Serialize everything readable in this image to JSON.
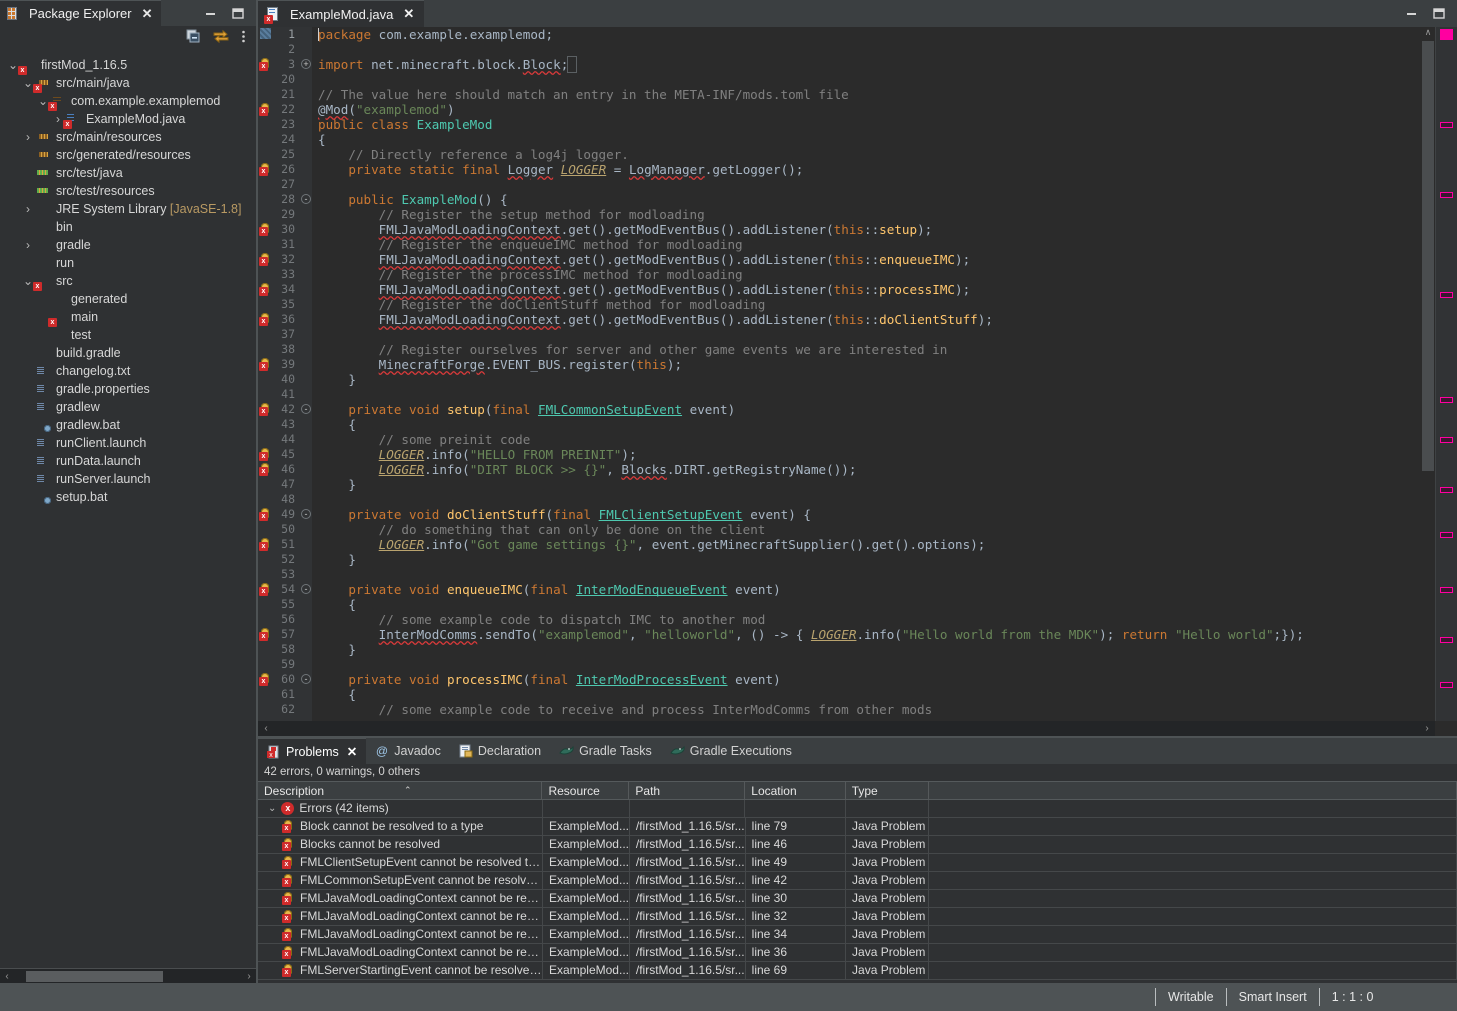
{
  "window": {
    "minimize_label": "Minimize",
    "maximize_label": "Maximize"
  },
  "package_explorer": {
    "tab_label": "Package Explorer",
    "tab_close": "✕",
    "icon": "package-explorer-icon",
    "toolbar": {
      "collapse_all": "collapse-all-icon",
      "link_with_editor": "link-with-editor-icon",
      "view_menu": "view-menu-icon"
    },
    "tree": [
      {
        "label": "firstMod_1.16.5",
        "indent": 0,
        "arrow": "down",
        "icon": "project",
        "error": true
      },
      {
        "label": "src/main/java",
        "indent": 1,
        "arrow": "down",
        "icon": "pkgfrag",
        "error": true
      },
      {
        "label": "com.example.examplemod",
        "indent": 2,
        "arrow": "down",
        "icon": "package",
        "error": true
      },
      {
        "label": "ExampleMod.java",
        "indent": 3,
        "arrow": "right",
        "icon": "java",
        "error": true
      },
      {
        "label": "src/main/resources",
        "indent": 1,
        "arrow": "right",
        "icon": "pkgfrag",
        "error": false
      },
      {
        "label": "src/generated/resources",
        "indent": 1,
        "arrow": "none",
        "icon": "pkgfrag",
        "error": false
      },
      {
        "label": "src/test/java",
        "indent": 1,
        "arrow": "none",
        "icon": "pkgfrag-green",
        "error": false
      },
      {
        "label": "src/test/resources",
        "indent": 1,
        "arrow": "none",
        "icon": "pkgfrag-green",
        "error": false
      },
      {
        "label": "JRE System Library ",
        "suffix": "[JavaSE-1.8]",
        "indent": 1,
        "arrow": "right",
        "icon": "library",
        "error": false
      },
      {
        "label": "bin",
        "indent": 1,
        "arrow": "none",
        "icon": "folder",
        "error": false
      },
      {
        "label": "gradle",
        "indent": 1,
        "arrow": "right",
        "icon": "folder",
        "error": false
      },
      {
        "label": "run",
        "indent": 1,
        "arrow": "none",
        "icon": "folder",
        "error": false
      },
      {
        "label": "src",
        "indent": 1,
        "arrow": "down",
        "icon": "folder",
        "error": true
      },
      {
        "label": "generated",
        "indent": 2,
        "arrow": "none",
        "icon": "folder",
        "error": false
      },
      {
        "label": "main",
        "indent": 2,
        "arrow": "none",
        "icon": "folder",
        "error": true
      },
      {
        "label": "test",
        "indent": 2,
        "arrow": "none",
        "icon": "folder",
        "error": false
      },
      {
        "label": "build.gradle",
        "indent": 1,
        "arrow": "none",
        "icon": "gradle",
        "error": false
      },
      {
        "label": "changelog.txt",
        "indent": 1,
        "arrow": "none",
        "icon": "file",
        "error": false
      },
      {
        "label": "gradle.properties",
        "indent": 1,
        "arrow": "none",
        "icon": "file",
        "error": false
      },
      {
        "label": "gradlew",
        "indent": 1,
        "arrow": "none",
        "icon": "file",
        "error": false
      },
      {
        "label": "gradlew.bat",
        "indent": 1,
        "arrow": "none",
        "icon": "bat",
        "error": false
      },
      {
        "label": "runClient.launch",
        "indent": 1,
        "arrow": "none",
        "icon": "file",
        "error": false
      },
      {
        "label": "runData.launch",
        "indent": 1,
        "arrow": "none",
        "icon": "file",
        "error": false
      },
      {
        "label": "runServer.launch",
        "indent": 1,
        "arrow": "none",
        "icon": "file",
        "error": false
      },
      {
        "label": "setup.bat",
        "indent": 1,
        "arrow": "none",
        "icon": "bat",
        "error": false
      }
    ],
    "hscroll": {
      "left_arrow": "‹",
      "right_arrow": "›"
    }
  },
  "editor": {
    "tab_label": "ExampleMod.java",
    "tab_close": "✕",
    "icon": "java-file-icon",
    "lines": [
      {
        "num": "1",
        "marker": false,
        "fold": "",
        "text": "package com.example.examplemod;"
      },
      {
        "num": "2",
        "marker": false,
        "fold": "",
        "text": ""
      },
      {
        "num": "3",
        "marker": true,
        "fold": "+",
        "text": "import net.minecraft.block.Block;"
      },
      {
        "num": "20",
        "marker": false,
        "fold": "",
        "text": ""
      },
      {
        "num": "21",
        "marker": false,
        "fold": "",
        "text": "// The value here should match an entry in the META-INF/mods.toml file"
      },
      {
        "num": "22",
        "marker": true,
        "fold": "",
        "text": "@Mod(\"examplemod\")"
      },
      {
        "num": "23",
        "marker": false,
        "fold": "",
        "text": "public class ExampleMod"
      },
      {
        "num": "24",
        "marker": false,
        "fold": "",
        "text": "{"
      },
      {
        "num": "25",
        "marker": false,
        "fold": "",
        "text": "    // Directly reference a log4j logger."
      },
      {
        "num": "26",
        "marker": true,
        "fold": "",
        "text": "    private static final Logger LOGGER = LogManager.getLogger();"
      },
      {
        "num": "27",
        "marker": false,
        "fold": "",
        "text": ""
      },
      {
        "num": "28",
        "marker": false,
        "fold": "-",
        "text": "    public ExampleMod() {"
      },
      {
        "num": "29",
        "marker": false,
        "fold": "",
        "text": "        // Register the setup method for modloading"
      },
      {
        "num": "30",
        "marker": true,
        "fold": "",
        "text": "        FMLJavaModLoadingContext.get().getModEventBus().addListener(this::setup);"
      },
      {
        "num": "31",
        "marker": false,
        "fold": "",
        "text": "        // Register the enqueueIMC method for modloading"
      },
      {
        "num": "32",
        "marker": true,
        "fold": "",
        "text": "        FMLJavaModLoadingContext.get().getModEventBus().addListener(this::enqueueIMC);"
      },
      {
        "num": "33",
        "marker": false,
        "fold": "",
        "text": "        // Register the processIMC method for modloading"
      },
      {
        "num": "34",
        "marker": true,
        "fold": "",
        "text": "        FMLJavaModLoadingContext.get().getModEventBus().addListener(this::processIMC);"
      },
      {
        "num": "35",
        "marker": false,
        "fold": "",
        "text": "        // Register the doClientStuff method for modloading"
      },
      {
        "num": "36",
        "marker": true,
        "fold": "",
        "text": "        FMLJavaModLoadingContext.get().getModEventBus().addListener(this::doClientStuff);"
      },
      {
        "num": "37",
        "marker": false,
        "fold": "",
        "text": ""
      },
      {
        "num": "38",
        "marker": false,
        "fold": "",
        "text": "        // Register ourselves for server and other game events we are interested in"
      },
      {
        "num": "39",
        "marker": true,
        "fold": "",
        "text": "        MinecraftForge.EVENT_BUS.register(this);"
      },
      {
        "num": "40",
        "marker": false,
        "fold": "",
        "text": "    }"
      },
      {
        "num": "41",
        "marker": false,
        "fold": "",
        "text": ""
      },
      {
        "num": "42",
        "marker": true,
        "fold": "-",
        "text": "    private void setup(final FMLCommonSetupEvent event)"
      },
      {
        "num": "43",
        "marker": false,
        "fold": "",
        "text": "    {"
      },
      {
        "num": "44",
        "marker": false,
        "fold": "",
        "text": "        // some preinit code"
      },
      {
        "num": "45",
        "marker": true,
        "fold": "",
        "text": "        LOGGER.info(\"HELLO FROM PREINIT\");"
      },
      {
        "num": "46",
        "marker": true,
        "fold": "",
        "text": "        LOGGER.info(\"DIRT BLOCK >> {}\", Blocks.DIRT.getRegistryName());"
      },
      {
        "num": "47",
        "marker": false,
        "fold": "",
        "text": "    }"
      },
      {
        "num": "48",
        "marker": false,
        "fold": "",
        "text": ""
      },
      {
        "num": "49",
        "marker": true,
        "fold": "-",
        "text": "    private void doClientStuff(final FMLClientSetupEvent event) {"
      },
      {
        "num": "50",
        "marker": false,
        "fold": "",
        "text": "        // do something that can only be done on the client"
      },
      {
        "num": "51",
        "marker": true,
        "fold": "",
        "text": "        LOGGER.info(\"Got game settings {}\", event.getMinecraftSupplier().get().options);"
      },
      {
        "num": "52",
        "marker": false,
        "fold": "",
        "text": "    }"
      },
      {
        "num": "53",
        "marker": false,
        "fold": "",
        "text": ""
      },
      {
        "num": "54",
        "marker": true,
        "fold": "-",
        "text": "    private void enqueueIMC(final InterModEnqueueEvent event)"
      },
      {
        "num": "55",
        "marker": false,
        "fold": "",
        "text": "    {"
      },
      {
        "num": "56",
        "marker": false,
        "fold": "",
        "text": "        // some example code to dispatch IMC to another mod"
      },
      {
        "num": "57",
        "marker": true,
        "fold": "",
        "text": "        InterModComms.sendTo(\"examplemod\", \"helloworld\", () -> { LOGGER.info(\"Hello world from the MDK\"); return \"Hello world\";});"
      },
      {
        "num": "58",
        "marker": false,
        "fold": "",
        "text": "    }"
      },
      {
        "num": "59",
        "marker": false,
        "fold": "",
        "text": ""
      },
      {
        "num": "60",
        "marker": true,
        "fold": "-",
        "text": "    private void processIMC(final InterModProcessEvent event)"
      },
      {
        "num": "61",
        "marker": false,
        "fold": "",
        "text": "    {"
      },
      {
        "num": "62",
        "marker": false,
        "fold": "",
        "text": "        // some example code to receive and process InterModComms from other mods"
      }
    ],
    "scroll": {
      "up_arrow": "∧",
      "down_arrow": "∨",
      "left_arrow": "‹",
      "right_arrow": "›"
    },
    "ruler_marker_color": "#ff00a0"
  },
  "problems": {
    "tabs": [
      {
        "label": "Problems",
        "icon": "problems-icon",
        "active": true,
        "close": "✕"
      },
      {
        "label": "Javadoc",
        "icon": "javadoc-icon",
        "active": false
      },
      {
        "label": "Declaration",
        "icon": "declaration-icon",
        "active": false
      },
      {
        "label": "Gradle Tasks",
        "icon": "gradle-icon",
        "active": false
      },
      {
        "label": "Gradle Executions",
        "icon": "gradle-icon",
        "active": false
      }
    ],
    "summary": "42 errors, 0 warnings, 0 others",
    "columns": [
      "Description",
      "Resource",
      "Path",
      "Location",
      "Type"
    ],
    "sort_indicator": "⌃",
    "group_row": {
      "label": "Errors (42 items)",
      "arrow": "∨"
    },
    "rows": [
      {
        "description": "Block cannot be resolved to a type",
        "resource": "ExampleMod....",
        "path": "/firstMod_1.16.5/sr...",
        "location": "line 79",
        "type": "Java Problem"
      },
      {
        "description": "Blocks cannot be resolved",
        "resource": "ExampleMod....",
        "path": "/firstMod_1.16.5/sr...",
        "location": "line 46",
        "type": "Java Problem"
      },
      {
        "description": "FMLClientSetupEvent cannot be resolved to a type",
        "resource": "ExampleMod....",
        "path": "/firstMod_1.16.5/sr...",
        "location": "line 49",
        "type": "Java Problem"
      },
      {
        "description": "FMLCommonSetupEvent cannot be resolved to a type",
        "resource": "ExampleMod....",
        "path": "/firstMod_1.16.5/sr...",
        "location": "line 42",
        "type": "Java Problem"
      },
      {
        "description": "FMLJavaModLoadingContext cannot be resolved",
        "resource": "ExampleMod....",
        "path": "/firstMod_1.16.5/sr...",
        "location": "line 30",
        "type": "Java Problem"
      },
      {
        "description": "FMLJavaModLoadingContext cannot be resolved",
        "resource": "ExampleMod....",
        "path": "/firstMod_1.16.5/sr...",
        "location": "line 32",
        "type": "Java Problem"
      },
      {
        "description": "FMLJavaModLoadingContext cannot be resolved",
        "resource": "ExampleMod....",
        "path": "/firstMod_1.16.5/sr...",
        "location": "line 34",
        "type": "Java Problem"
      },
      {
        "description": "FMLJavaModLoadingContext cannot be resolved",
        "resource": "ExampleMod....",
        "path": "/firstMod_1.16.5/sr...",
        "location": "line 36",
        "type": "Java Problem"
      },
      {
        "description": "FMLServerStartingEvent cannot be resolved to",
        "resource": "ExampleMod...",
        "path": "/firstMod_1.16.5/sr...",
        "location": "line 69",
        "type": "Java Problem"
      }
    ]
  },
  "statusbar": {
    "writable": "Writable",
    "insert_mode": "Smart Insert",
    "position": "1 : 1 : 0"
  }
}
